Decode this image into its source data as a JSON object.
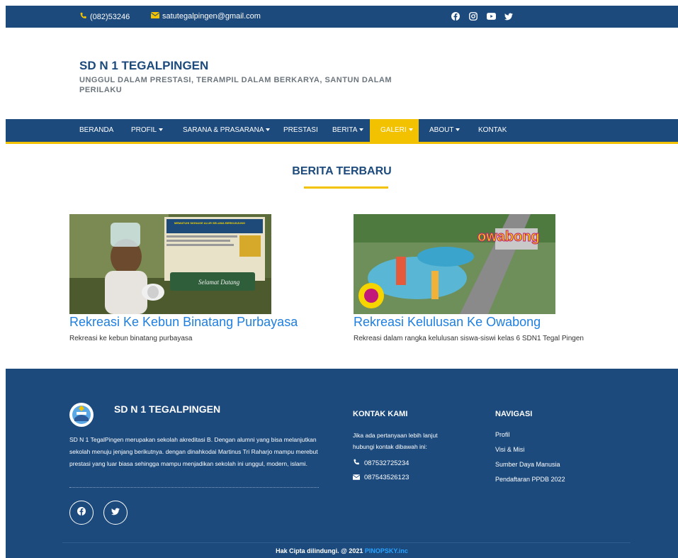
{
  "topbar": {
    "phone": "(082)53246",
    "email": "satutegalpingen@gmail.com",
    "social_icons": [
      "facebook-icon",
      "instagram-icon",
      "youtube-icon",
      "twitter-icon"
    ]
  },
  "brand": {
    "title": "SD N 1 TEGALPINGEN",
    "tagline": "UNGGUL DALAM PRESTASI, TERAMPIL DALAM BERKARYA, SANTUN DALAM PERILAKU"
  },
  "nav": {
    "items": [
      {
        "label": "BERANDA",
        "dropdown": false
      },
      {
        "label": "PROFIL",
        "dropdown": true
      },
      {
        "label": "SARANA & PRASARANA",
        "dropdown": true
      },
      {
        "label": "PRESTASI",
        "dropdown": false
      },
      {
        "label": "BERITA",
        "dropdown": true
      },
      {
        "label": "GALERI",
        "dropdown": true,
        "active": true
      },
      {
        "label": "ABOUT",
        "dropdown": true
      },
      {
        "label": "KONTAK",
        "dropdown": false
      }
    ]
  },
  "news": {
    "heading": "BERITA TERBARU",
    "items": [
      {
        "title": "Rekreasi Ke Kebun Binatang Purbayasa",
        "desc": "Rekreasi ke kebun binatang purbayasa"
      },
      {
        "title": "Rekreasi Kelulusan Ke Owabong",
        "desc": "Rekreasi dalam rangka kelulusan siswa-siswi kelas 6 SDN1 Tegal Pingen"
      }
    ],
    "image1_sign_title": "MEMATUHI SIGNAGE ALUR SELAMA BERKUNJUNG",
    "image1_banner": "Selamat Datang",
    "image2_logo": "owabong"
  },
  "footer": {
    "title": "SD N 1 TEGALPINGEN",
    "description": "SD N 1 TegalPingen merupakan sekolah akreditasi B. Dengan alumni yang bisa melanjutkan sekolah menuju jenjang berikutnya. dengan dinahkodai Martinus Tri Raharjo mampu merebut prestasi yang luar biasa sehingga mampu menjadikan sekolah ini unggul, modern, islami.",
    "contact": {
      "heading": "KONTAK KAMI",
      "text": "Jika ada pertanyaan lebih lanjut hubungi kontak dibawah ini:",
      "phone": "087532725234",
      "whatsapp": "087543526123"
    },
    "navigasi": {
      "heading": "NAVIGASI",
      "links": [
        "Profil",
        "Visi & Misi",
        "Sumber Daya Manusia",
        "Pendaftaran PPDB 2022"
      ]
    },
    "copyright_text": "Hak Cipta dilindungi. @ 2021 ",
    "copyright_brand": "PINOPSKY.inc"
  },
  "colors": {
    "primary": "#1c4a7c",
    "accent": "#f2c200",
    "link": "#1f7fe0"
  }
}
